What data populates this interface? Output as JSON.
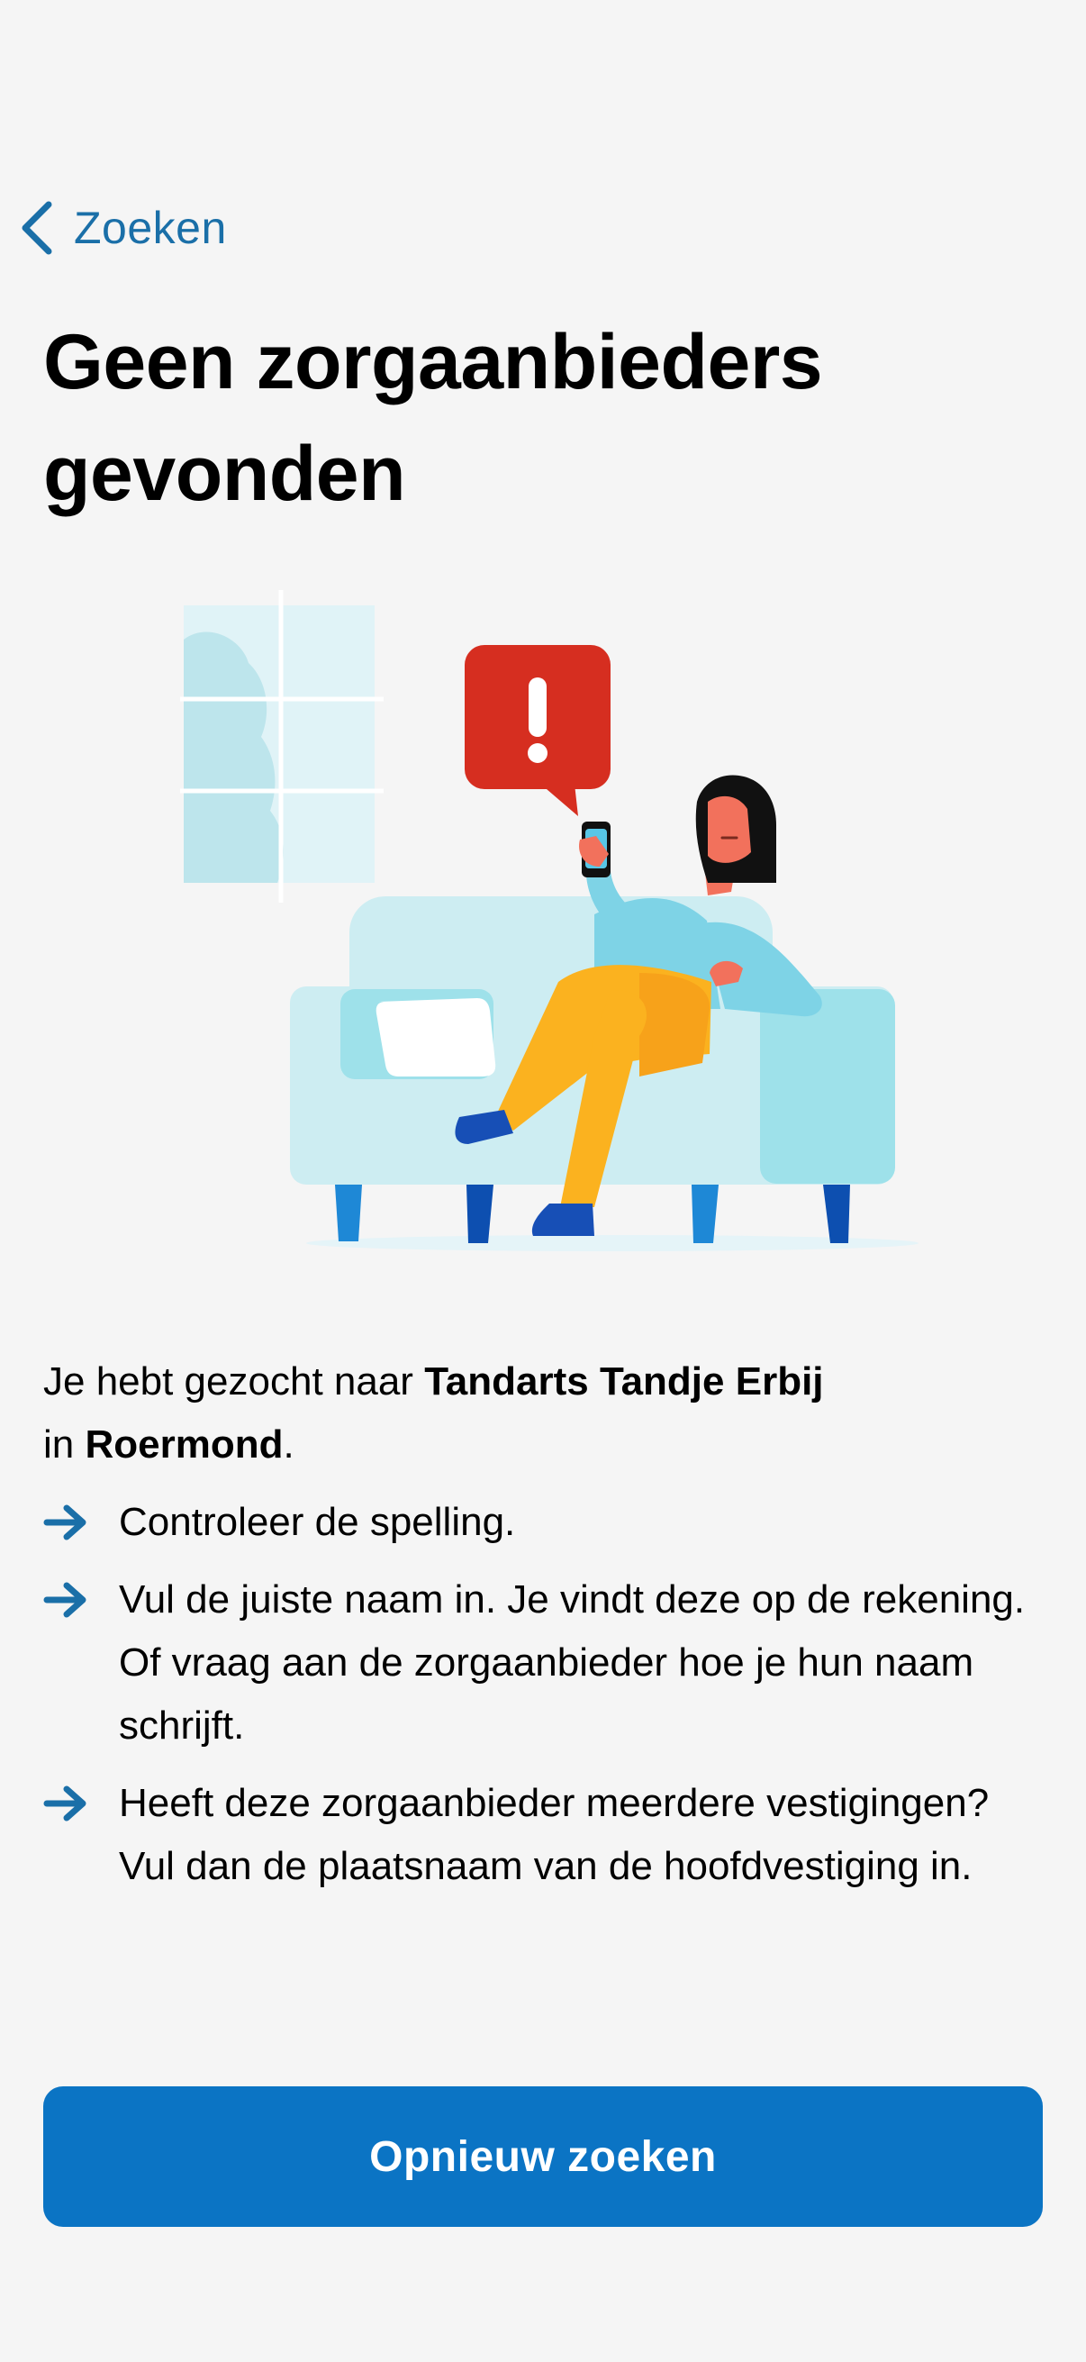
{
  "nav": {
    "back_label": "Zoeken"
  },
  "title": "Geen zorgaanbieders gevonden",
  "intro": {
    "prefix": "Je hebt gezocht naar ",
    "provider": "Tandarts Tandje Erbij",
    "middle": "in ",
    "place": "Roermond",
    "suffix": "."
  },
  "tips": [
    {
      "text": "Controleer de spelling."
    },
    {
      "text": "Vul de juiste naam in. Je vindt deze op de rekening. Of vraag aan de zorgaanbieder hoe je hun naam schrijft."
    },
    {
      "text": "Heeft deze zorgaanbieder meerdere vestigingen? Vul dan de plaatsnaam van de hoofdvestiging in."
    }
  ],
  "button": {
    "label": "Opnieuw zoeken"
  },
  "icons": {
    "back": "chevron-left-icon",
    "tip": "arrow-right-icon",
    "alert": "exclamation-icon"
  },
  "colors": {
    "background": "#f5f5f5",
    "link": "#1a6fa8",
    "button": "#0b74c4",
    "arrow": "#1a6fa8",
    "alert": "#d62e20"
  }
}
